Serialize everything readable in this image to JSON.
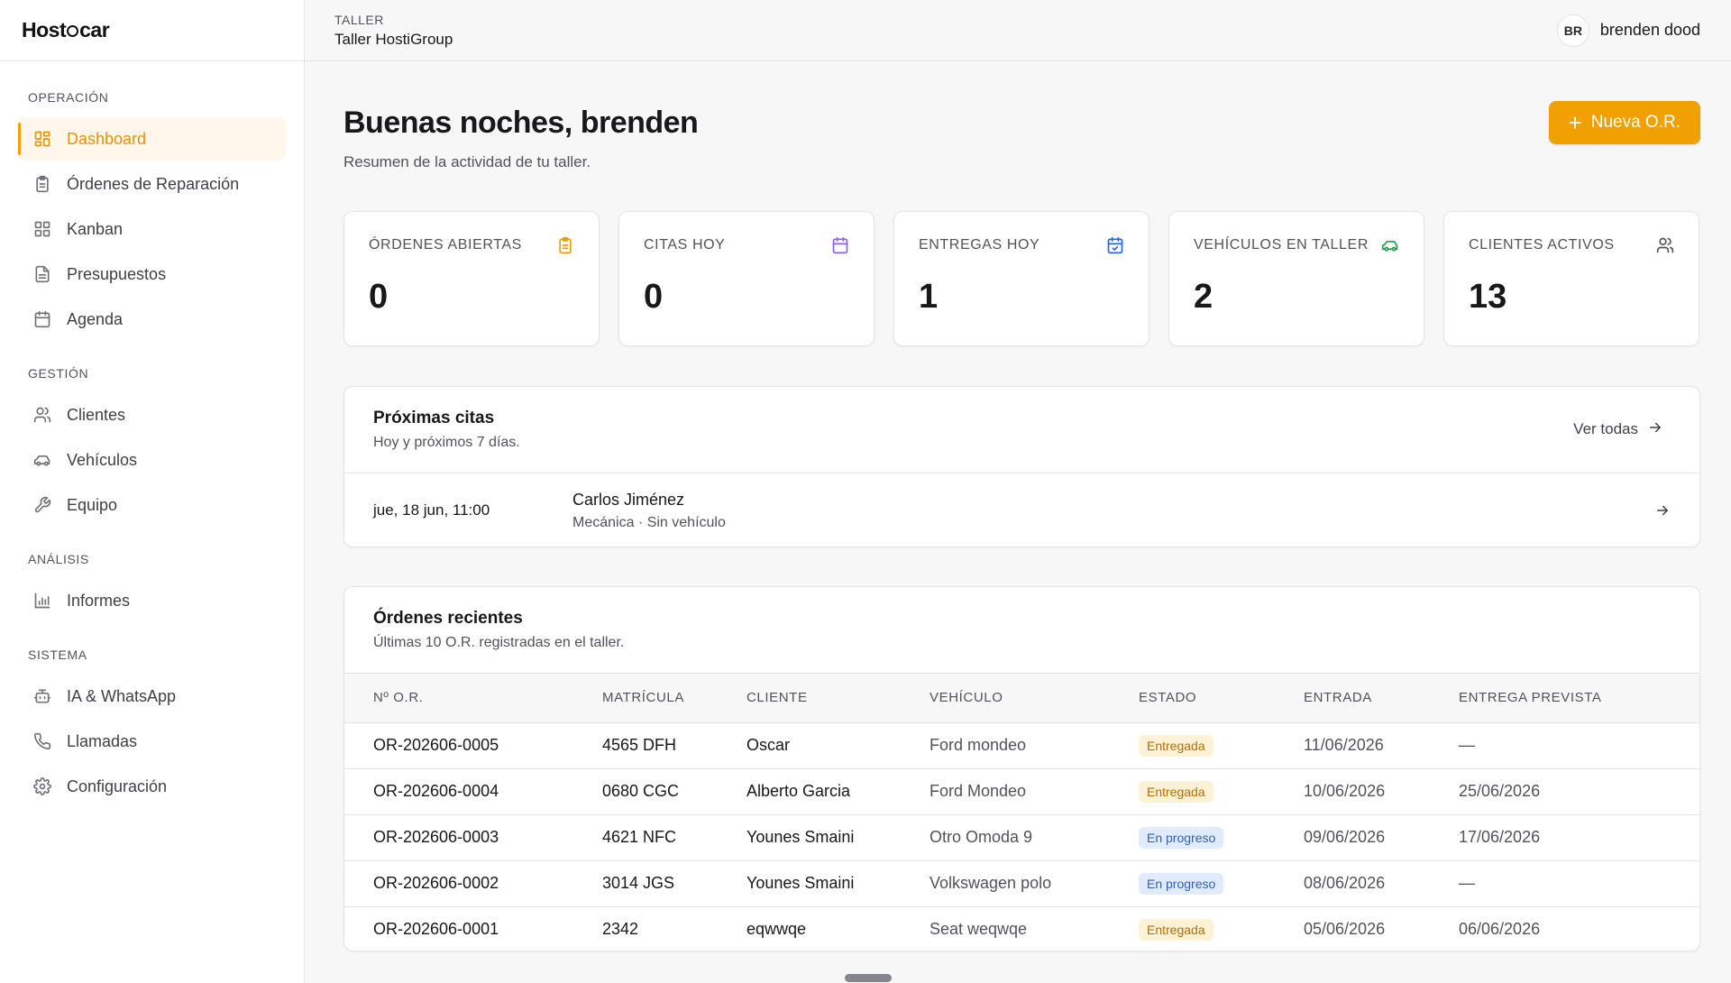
{
  "app": {
    "logo_text_left": "Host",
    "logo_text_right": "car"
  },
  "sidebar": {
    "sections": [
      {
        "title": "OPERACIÓN",
        "items": [
          {
            "label": "Dashboard",
            "icon": "dashboard-grid-icon",
            "active": true
          },
          {
            "label": "Órdenes de Reparación",
            "icon": "clipboard-icon"
          },
          {
            "label": "Kanban",
            "icon": "kanban-grid-icon"
          },
          {
            "label": "Presupuestos",
            "icon": "document-icon"
          },
          {
            "label": "Agenda",
            "icon": "calendar-icon"
          }
        ]
      },
      {
        "title": "GESTIÓN",
        "items": [
          {
            "label": "Clientes",
            "icon": "users-icon"
          },
          {
            "label": "Vehículos",
            "icon": "car-icon"
          },
          {
            "label": "Equipo",
            "icon": "wrench-icon"
          }
        ]
      },
      {
        "title": "ANÁLISIS",
        "items": [
          {
            "label": "Informes",
            "icon": "bar-chart-icon"
          }
        ]
      },
      {
        "title": "SISTEMA",
        "items": [
          {
            "label": "IA & WhatsApp",
            "icon": "bot-icon"
          },
          {
            "label": "Llamadas",
            "icon": "phone-icon"
          },
          {
            "label": "Configuración",
            "icon": "gear-icon"
          }
        ]
      }
    ]
  },
  "topbar": {
    "workshop_label": "TALLER",
    "workshop_name": "Taller HostiGroup",
    "user_initials": "BR",
    "user_name": "brenden dood"
  },
  "header": {
    "greeting": "Buenas noches, brenden",
    "subtitle": "Resumen de la actividad de tu taller.",
    "new_order_label": "Nueva O.R."
  },
  "stats": [
    {
      "label": "ÓRDENES ABIERTAS",
      "value": "0",
      "icon": "clipboard-icon",
      "color": "#e8a000"
    },
    {
      "label": "CITAS HOY",
      "value": "0",
      "icon": "calendar-icon",
      "color": "#8b5cf6"
    },
    {
      "label": "ENTREGAS HOY",
      "value": "1",
      "icon": "calendar-check-icon",
      "color": "#2563eb"
    },
    {
      "label": "VEHÍCULOS EN TALLER",
      "value": "2",
      "icon": "car-icon",
      "color": "#16a34a"
    },
    {
      "label": "CLIENTES ACTIVOS",
      "value": "13",
      "icon": "users-icon",
      "color": "#52525b"
    }
  ],
  "appointments": {
    "title": "Próximas citas",
    "subtitle": "Hoy y próximos 7 días.",
    "view_all": "Ver todas",
    "items": [
      {
        "date": "jue, 18 jun, 11:00",
        "client": "Carlos Jiménez",
        "detail": "Mecánica · Sin vehículo"
      }
    ]
  },
  "orders": {
    "title": "Órdenes recientes",
    "subtitle": "Últimas 10 O.R. registradas en el taller.",
    "columns": [
      "Nº O.R.",
      "MATRÍCULA",
      "CLIENTE",
      "VEHÍCULO",
      "ESTADO",
      "ENTRADA",
      "ENTREGA PREVISTA"
    ],
    "rows": [
      {
        "id": "OR-202606-0005",
        "plate": "4565 DFH",
        "client": "Oscar",
        "vehicle": "Ford mondeo",
        "status": "Entregada",
        "status_type": "delivered",
        "entry": "11/06/2026",
        "due": "—"
      },
      {
        "id": "OR-202606-0004",
        "plate": "0680 CGC",
        "client": "Alberto Garcia",
        "vehicle": "Ford Mondeo",
        "status": "Entregada",
        "status_type": "delivered",
        "entry": "10/06/2026",
        "due": "25/06/2026"
      },
      {
        "id": "OR-202606-0003",
        "plate": "4621 NFC",
        "client": "Younes Smaini",
        "vehicle": "Otro Omoda 9",
        "status": "En progreso",
        "status_type": "progress",
        "entry": "09/06/2026",
        "due": "17/06/2026"
      },
      {
        "id": "OR-202606-0002",
        "plate": "3014 JGS",
        "client": "Younes Smaini",
        "vehicle": "Volkswagen polo",
        "status": "En progreso",
        "status_type": "progress",
        "entry": "08/06/2026",
        "due": "—"
      },
      {
        "id": "OR-202606-0001",
        "plate": "2342",
        "client": "eqwwqe",
        "vehicle": "Seat weqwqe",
        "status": "Entregada",
        "status_type": "delivered",
        "entry": "05/06/2026",
        "due": "06/06/2026"
      }
    ]
  },
  "theme": {
    "accent": "#f0a000",
    "delivered_bg": "#fdf1d6",
    "progress_bg": "#e0ecfd"
  }
}
